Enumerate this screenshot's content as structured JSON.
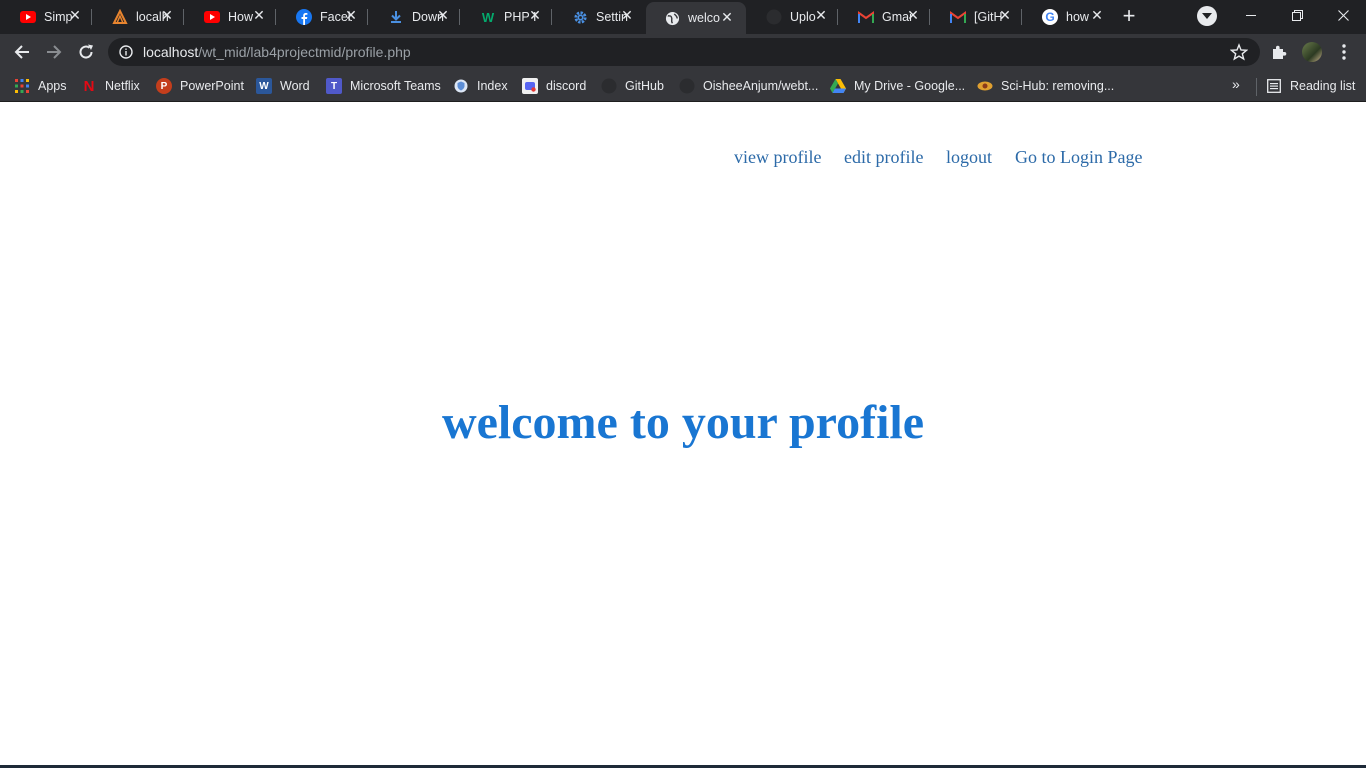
{
  "browser": {
    "tabs": [
      {
        "label": "Simp",
        "icon": "youtube-icon",
        "active": false
      },
      {
        "label": "localh",
        "icon": "xampp-icon",
        "active": false
      },
      {
        "label": "How",
        "icon": "youtube-icon",
        "active": false
      },
      {
        "label": "Faceb",
        "icon": "facebook-icon",
        "active": false
      },
      {
        "label": "Down",
        "icon": "download-icon",
        "active": false
      },
      {
        "label": "PHP I",
        "icon": "w3schools-icon",
        "active": false
      },
      {
        "label": "Settin",
        "icon": "settings-gear-icon",
        "active": false
      },
      {
        "label": "welco",
        "icon": "globe-icon",
        "active": true
      },
      {
        "label": "Uplo",
        "icon": "github-icon",
        "active": false
      },
      {
        "label": "Gmai",
        "icon": "gmail-icon",
        "active": false
      },
      {
        "label": "[GitH",
        "icon": "gmail-icon",
        "active": false
      },
      {
        "label": "how",
        "icon": "google-icon",
        "active": false
      }
    ],
    "url_host": "localhost",
    "url_path": "/wt_mid/lab4projectmid/profile.php",
    "bookmarks": [
      {
        "label": "Apps",
        "icon": "apps-grid-icon",
        "color": "#ea4335"
      },
      {
        "label": "Netflix",
        "icon": "netflix-icon",
        "color": "#e50914"
      },
      {
        "label": "PowerPoint",
        "icon": "powerpoint-icon",
        "color": "#c43e1c"
      },
      {
        "label": "Word",
        "icon": "word-icon",
        "color": "#2b579a"
      },
      {
        "label": "Microsoft Teams",
        "icon": "teams-icon",
        "color": "#5059c9"
      },
      {
        "label": "Index",
        "icon": "shield-icon",
        "color": "#5b8dd6"
      },
      {
        "label": "discord",
        "icon": "discord-icon",
        "color": "#5865f2"
      },
      {
        "label": "GitHub",
        "icon": "github-icon",
        "color": "#24292e"
      },
      {
        "label": "OisheeAnjum/webt...",
        "icon": "github-icon",
        "color": "#24292e"
      },
      {
        "label": "My Drive - Google...",
        "icon": "google-drive-icon",
        "color": "#34a853"
      },
      {
        "label": "Sci-Hub: removing...",
        "icon": "scihub-icon",
        "color": "#e0a030"
      }
    ],
    "more_bookmarks": "»",
    "reading_list": "Reading list"
  },
  "page": {
    "nav": {
      "view_profile": "view profile",
      "edit_profile": "edit profile",
      "logout": "logout",
      "login_page": "Go to Login Page"
    },
    "welcome": "welcome to your profile"
  },
  "colors": {
    "tabstrip_bg": "#202124",
    "toolbar_bg": "#35363a",
    "nav_link": "#2c6aa8",
    "welcome_text": "#1976d2"
  }
}
